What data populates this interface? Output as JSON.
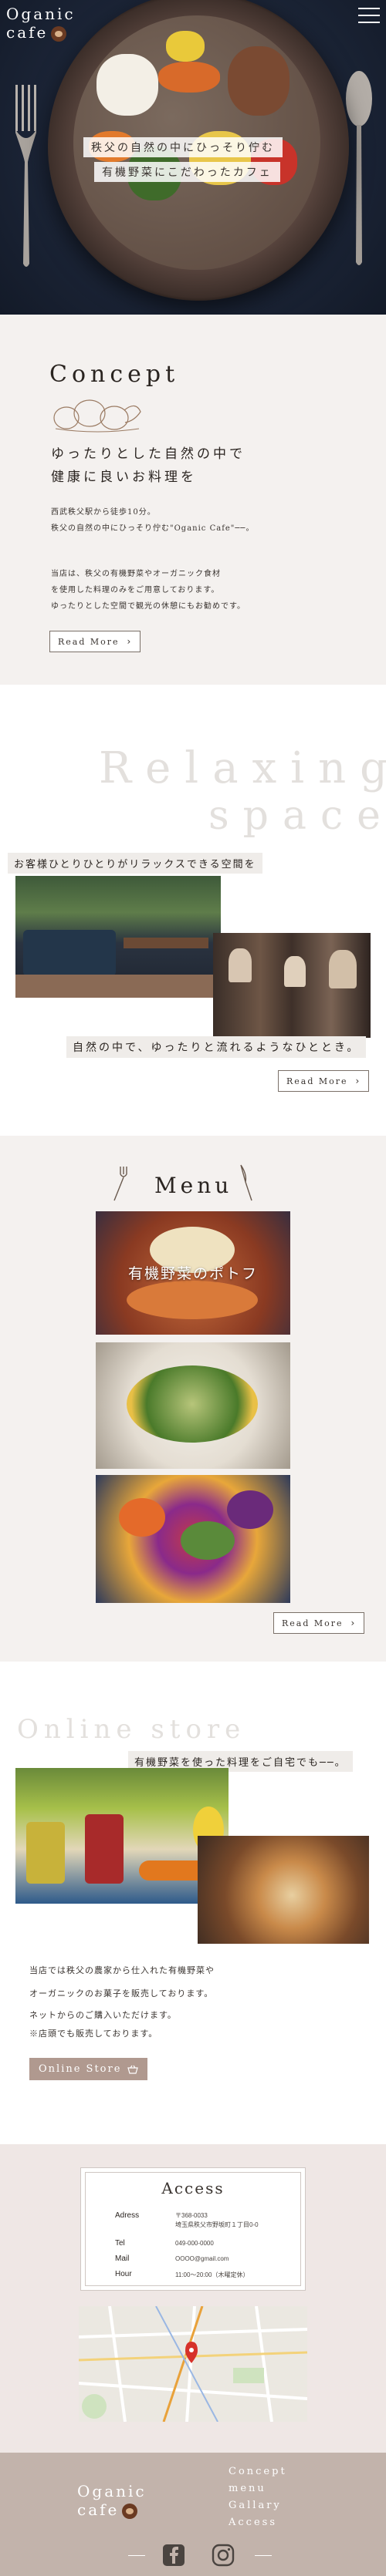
{
  "header": {
    "logo_line1": "Oganic",
    "logo_line2": "cafe",
    "tagline1": "秩父の自然の中にひっそり佇む",
    "tagline2": "有機野菜にこだわったカフェ"
  },
  "concept": {
    "title": "Concept",
    "lead1": "ゆったりとした自然の中で",
    "lead2": "健康に良いお料理を",
    "p1_line1": "西武秩父駅から徒歩10分。",
    "p1_line2": "秩父の自然の中にひっそり佇む\"Oganic Cafe\"──。",
    "p2_line1": "当店は、秩父の有機野菜やオーガニック食材",
    "p2_line2": "を使用した料理のみをご用意しております。",
    "p2_line3": "ゆったりとした空間で観光の休憩にもお勧めです。",
    "read_more": "Read More"
  },
  "relax": {
    "ghost1": "Relaxing",
    "ghost2": "space",
    "caption1": "お客様ひとりひとりがリラックスできる空間を",
    "caption2": "自然の中で、ゆったりと流れるようなひととき。",
    "read_more": "Read More"
  },
  "menu": {
    "title": "Menu",
    "item1_label": "有機野菜のポトフ",
    "read_more": "Read More"
  },
  "online": {
    "ghost": "Online store",
    "strip": "有機野菜を使った料理をご自宅でも──。",
    "p1": "当店では秩父の農家から仕入れた有機野菜や",
    "p2": "オーガニックのお菓子を販売しております。",
    "p3": "ネットからのご購入いただけます。",
    "p4": "※店頭でも販売しております。",
    "button": "Online Store"
  },
  "access": {
    "title": "Access",
    "rows": [
      {
        "label": "Adress",
        "value1": "〒368-0033",
        "value2": "埼玉県秩父市野坂町１丁目0-0"
      },
      {
        "label": "Tel",
        "value1": "049-000-0000",
        "value2": ""
      },
      {
        "label": "Mail",
        "value1": "OOOO@gmail.com",
        "value2": ""
      },
      {
        "label": "Hour",
        "value1": "11:00～20:00（木曜定休）",
        "value2": ""
      }
    ]
  },
  "footer": {
    "logo_line1": "Oganic",
    "logo_line2": "cafe",
    "nav": [
      "Concept",
      "menu",
      "Gallary",
      "Access"
    ]
  },
  "icons": [
    "hamburger-icon",
    "cup-icon",
    "chevron-right-icon",
    "basket-icon",
    "fork-icon",
    "knife-icon",
    "facebook-icon",
    "instagram-icon"
  ],
  "colors": {
    "hero_bg": "#1f2a3e",
    "section_bg": "#f4f1ef",
    "accent": "#b0998f",
    "footer_bg": "#c2b3ab"
  }
}
